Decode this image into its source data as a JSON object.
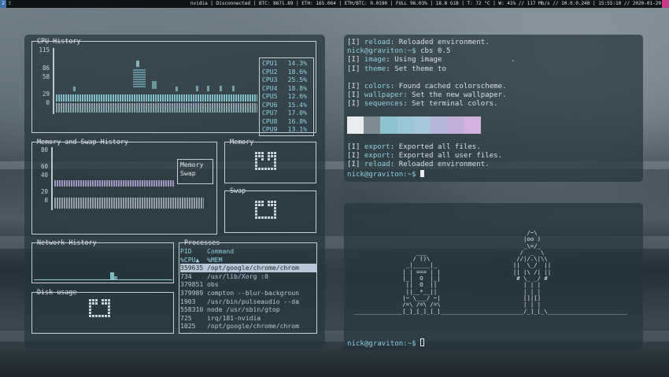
{
  "topbar": {
    "workspaces": [
      "2",
      "3"
    ],
    "status": "nvidia | Disconnected | BTC: 8671.89 | ETH: 165.064 | ETH/BTC: 0.0190 | FULL 96.03% | 18.8 GiB | T: 72 °C | W: 41% // 117 Mb/s // 10.0.0.248 | 15:55:10 // 2020-01-20"
  },
  "cpu": {
    "title": "CPU History",
    "y_labels": [
      "115",
      "86",
      "58",
      "29",
      "0"
    ],
    "legend": [
      {
        "name": "CPU1",
        "value": "14.3%"
      },
      {
        "name": "CPU2",
        "value": "18.6%"
      },
      {
        "name": "CPU3",
        "value": "25.5%"
      },
      {
        "name": "CPU4",
        "value": "18.8%"
      },
      {
        "name": "CPU5",
        "value": "12.6%"
      },
      {
        "name": "CPU6",
        "value": "15.4%"
      },
      {
        "name": "CPU7",
        "value": "17.0%"
      },
      {
        "name": "CPU8",
        "value": "16.8%"
      },
      {
        "name": "CPU9",
        "value": "13.1%"
      }
    ]
  },
  "memswap": {
    "title": "Memory and Swap History",
    "y_labels": [
      "80",
      "60",
      "40",
      "20",
      "0"
    ],
    "legend": [
      "Memory",
      "Swap"
    ]
  },
  "memory": {
    "title": "Memory"
  },
  "swap": {
    "title": "Swap"
  },
  "network": {
    "title": "Network History"
  },
  "disk": {
    "title": "Disk usage"
  },
  "processes": {
    "title": "Processes",
    "headers": [
      "PID",
      "Command"
    ],
    "sort_headers": [
      "%CPU▲",
      "%MEM"
    ],
    "rows": [
      {
        "pid": "359635",
        "cmd": "/opt/google/chrome/chrom",
        "selected": true
      },
      {
        "pid": "734",
        "cmd": "/usr/lib/Xorg :0"
      },
      {
        "pid": "379851",
        "cmd": "obs"
      },
      {
        "pid": "379989",
        "cmd": "compton --blur-backgroun"
      },
      {
        "pid": "1903",
        "cmd": "/usr/bin/pulseaudio --da"
      },
      {
        "pid": "558310",
        "cmd": "node /usr/sbin/gtop"
      },
      {
        "pid": "725",
        "cmd": "irq/181-nvidia"
      },
      {
        "pid": "1025",
        "cmd": "/opt/google/chrome/chrom"
      }
    ]
  },
  "terminal1": {
    "lines": [
      {
        "tag": "[I] ",
        "key": "reload",
        "text": ": Reloaded environment."
      },
      {
        "prompt": "nick@graviton:~$ ",
        "text": "cbs 0.5"
      },
      {
        "tag": "[I] ",
        "key": "image",
        "text": ": Using image                ."
      },
      {
        "tag": "[I] ",
        "key": "theme",
        "text": ": Set theme to"
      },
      {
        "tag": "",
        "key": "",
        "text": ""
      },
      {
        "tag": "[I] ",
        "key": "colors",
        "text": ": Found cached colorscheme."
      },
      {
        "tag": "[I] ",
        "key": "wallpaper",
        "text": ": Set the new wallpaper."
      },
      {
        "tag": "[I] ",
        "key": "sequences",
        "text": ": Set terminal colors."
      }
    ],
    "swatch_colors": [
      "#e8ecef",
      "#7e8a92",
      "#8cc3cf",
      "#9ac6d6",
      "#a7c8d9",
      "#b4b7da",
      "#c3aed8",
      "#d3b3dd"
    ],
    "lines_after": [
      {
        "tag": "[I] ",
        "key": "export",
        "text": ": Exported all files."
      },
      {
        "tag": "[I] ",
        "key": "export",
        "text": ": Exported all user files."
      },
      {
        "tag": "[I] ",
        "key": "reload",
        "text": ": Reloaded environment."
      }
    ],
    "prompt": "nick@graviton:~$ "
  },
  "terminal2": {
    "ascii": "                                                    /~\\\n                                                   |oo )\n                                                   _\\=/_\n                    ___                           /  _  \\\n                   / ()\\                         //|/.\\|\\\\\n                 _|_____|_                      ||  \\_/  ||\n                | | === | |                     || |\\ /| ||\n                |_|  O  |_|                      # \\_ _/ #\n                 ||  O  ||                         | | |\n                 ||__*__||                         | | |\n                |~ \\___/ ~|                        []|[]\n                /=\\ /=\\ /=\\                        | | |\n  ______________[_]_[_]_[_]________________________/_]_[_\\_______________________",
    "prompt": "nick@graviton:~$ "
  },
  "colors": {
    "accent": "#8fd2dc",
    "selection": "#b9c7d6",
    "workspace_active": "#3c6ea8",
    "topbar_end": "#c93a8a"
  }
}
